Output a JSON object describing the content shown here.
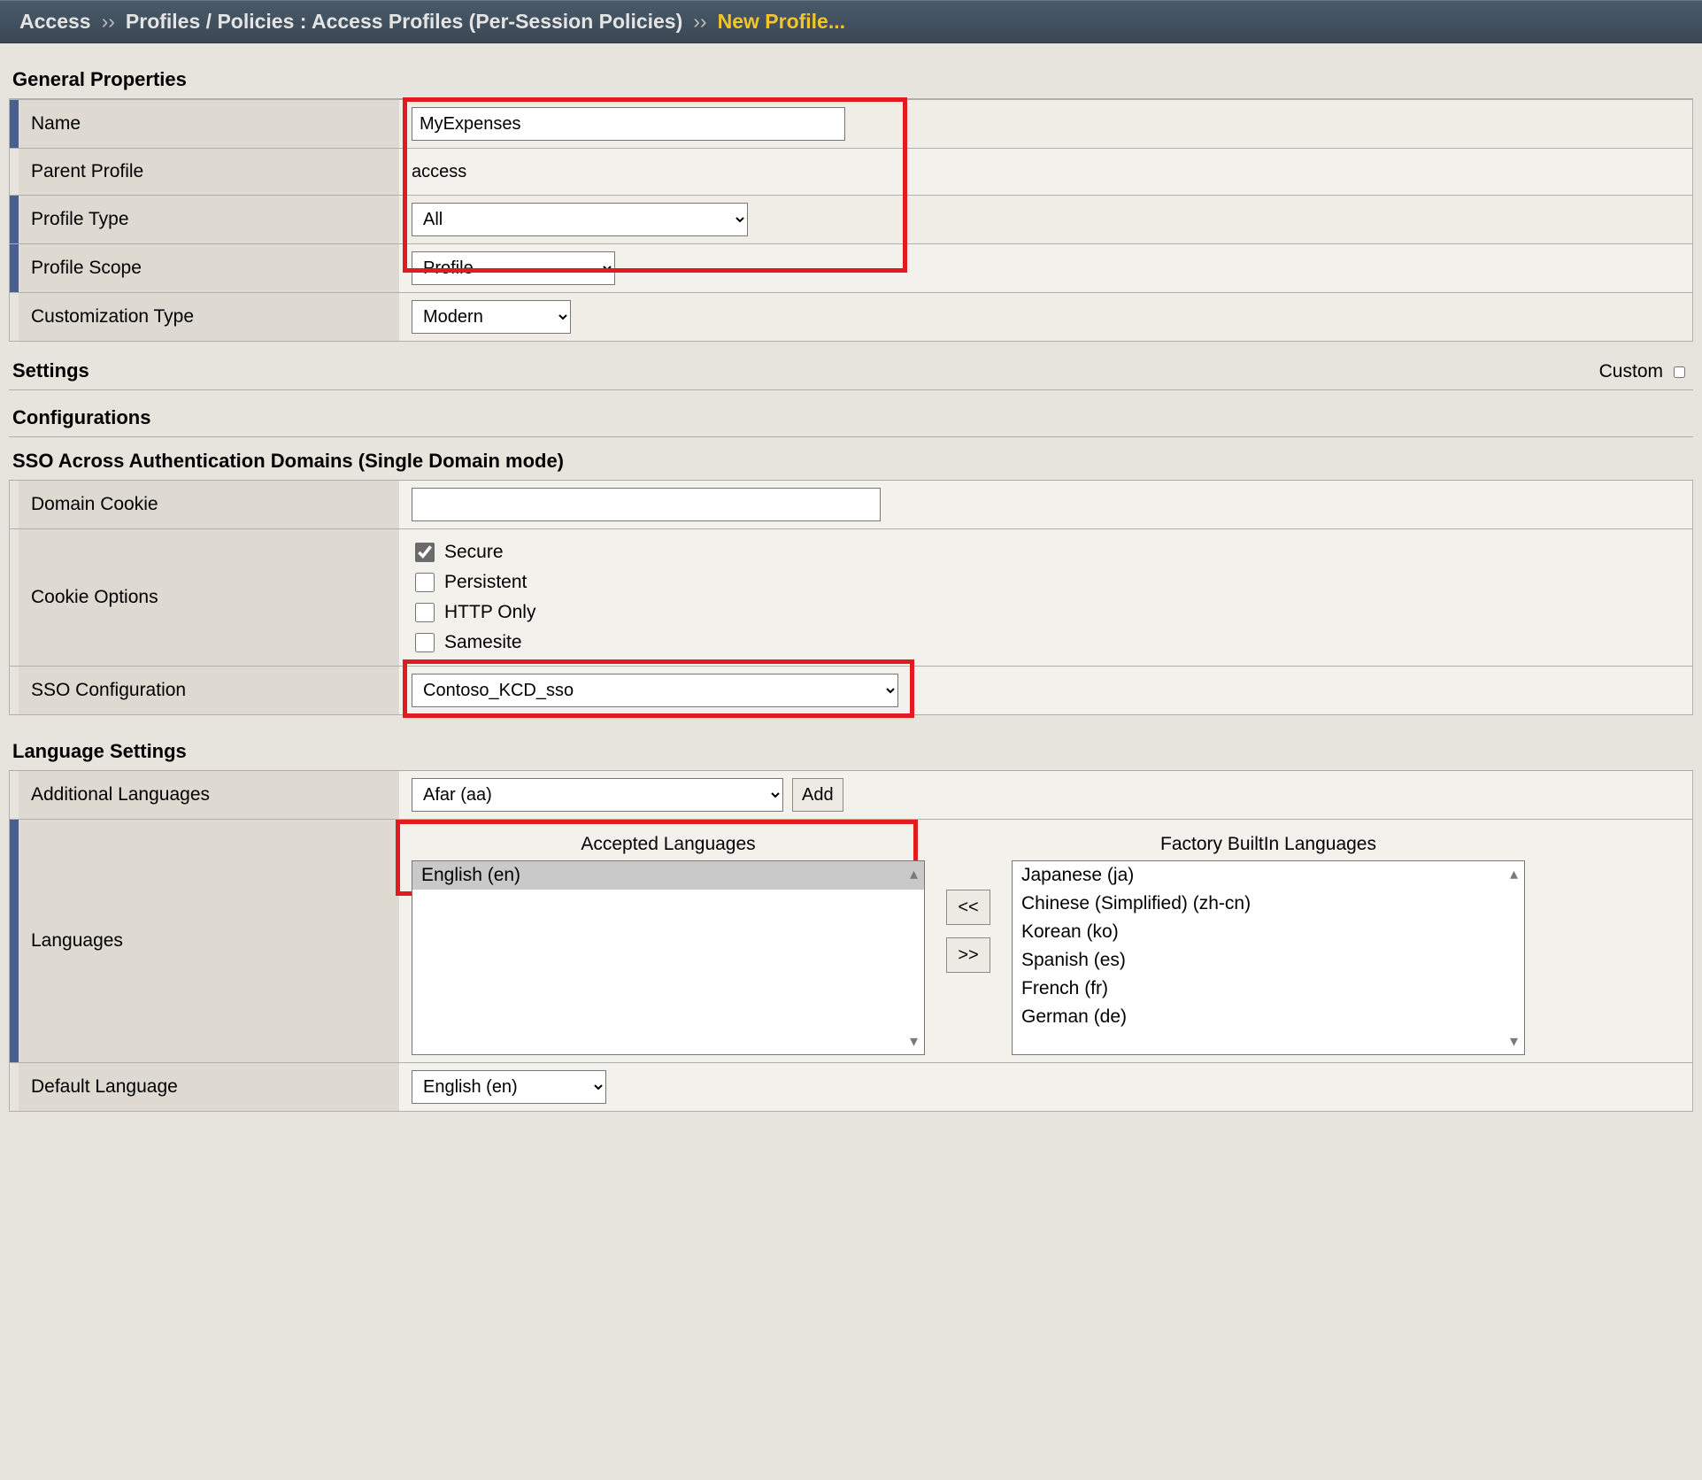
{
  "breadcrumb": {
    "root": "Access",
    "sep": "››",
    "mid": "Profiles / Policies : Access Profiles (Per-Session Policies)",
    "current": "New Profile..."
  },
  "sections": {
    "general": "General Properties",
    "settings": "Settings",
    "custom_label": "Custom",
    "configurations": "Configurations",
    "sso_domains": "SSO Across Authentication Domains (Single Domain mode)",
    "language": "Language Settings"
  },
  "general": {
    "name_label": "Name",
    "name_value": "MyExpenses",
    "parent_label": "Parent Profile",
    "parent_value": "access",
    "profile_type_label": "Profile Type",
    "profile_type_value": "All",
    "profile_scope_label": "Profile Scope",
    "profile_scope_value": "Profile",
    "customization_type_label": "Customization Type",
    "customization_type_value": "Modern"
  },
  "sso": {
    "domain_cookie_label": "Domain Cookie",
    "domain_cookie_value": "",
    "cookie_options_label": "Cookie Options",
    "opt_secure": "Secure",
    "opt_persistent": "Persistent",
    "opt_http_only": "HTTP Only",
    "opt_samesite": "Samesite",
    "sso_config_label": "SSO Configuration",
    "sso_config_value": "Contoso_KCD_sso"
  },
  "lang": {
    "additional_label": "Additional Languages",
    "additional_value": "Afar (aa)",
    "add_button": "Add",
    "languages_label": "Languages",
    "accepted_title": "Accepted Languages",
    "factory_title": "Factory BuiltIn Languages",
    "accepted_items": [
      "English (en)"
    ],
    "factory_items": [
      "Japanese (ja)",
      "Chinese (Simplified) (zh-cn)",
      "Korean (ko)",
      "Spanish (es)",
      "French (fr)",
      "German (de)"
    ],
    "move_left": "<<",
    "move_right": ">>",
    "default_label": "Default Language",
    "default_value": "English (en)"
  }
}
